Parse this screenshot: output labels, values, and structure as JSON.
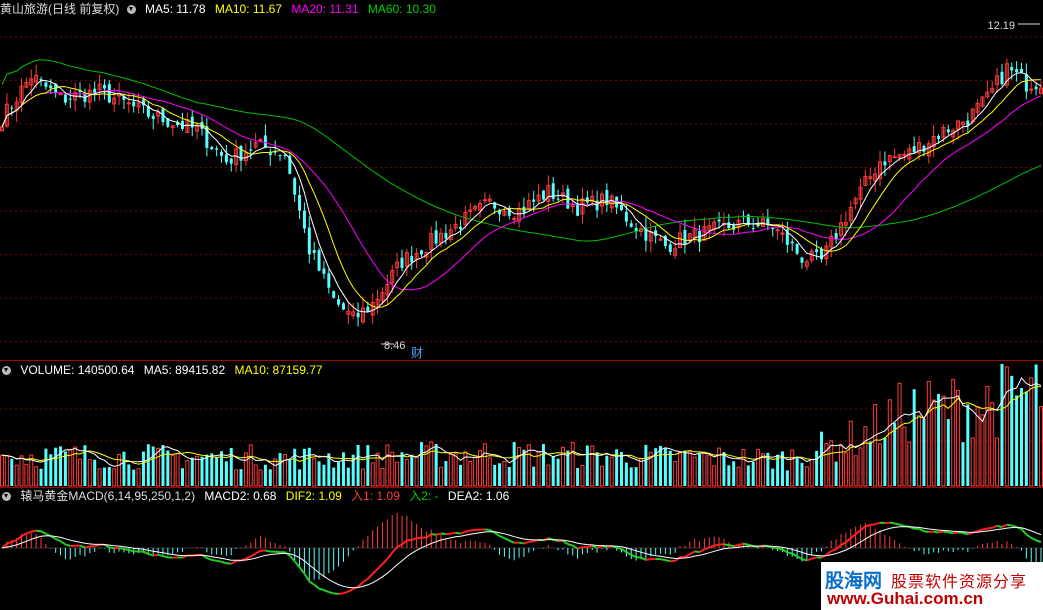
{
  "stock": {
    "name": "黄山旅游",
    "period": "(日线 前复权)"
  },
  "price_panel": {
    "ma5": "MA5: 11.78",
    "ma10": "MA10: 11.67",
    "ma20": "MA20: 11.31",
    "ma60": "MA60: 10.30",
    "high_label": "12.19",
    "low_label": "8.46",
    "event_marker": "财"
  },
  "volume_panel": {
    "volume": "VOLUME: 140500.64",
    "ma5": "MA5: 89415.82",
    "ma10": "MA10: 87159.77"
  },
  "macd_panel": {
    "name": "辕马黄金MACD(6,14,95,250,1,2)",
    "macd2": "MACD2: 0.68",
    "dif2": "DIF2: 1.09",
    "in1": "入1: 1.09",
    "in2": "入2: -",
    "dea2": "DEA2: 1.06"
  },
  "watermark": {
    "logo": "股海网",
    "tagline": "股票软件资源分享",
    "url": "www.Guhai.com.cn"
  },
  "colors": {
    "up": "#ff3c3c",
    "down": "#54ffff",
    "ma5": "#ffffff",
    "ma10": "#ffff00",
    "ma20": "#ff00ff",
    "ma60": "#00c000",
    "separator": "#a00000",
    "grid": "#7a0000"
  },
  "chart_data": [
    {
      "type": "candlestick",
      "title": "黄山旅游 (日线 前复权)",
      "ylim": [
        8.2,
        12.6
      ],
      "grid": true,
      "annotations": [
        {
          "text": "12.19",
          "kind": "period-high"
        },
        {
          "text": "8.46",
          "kind": "period-low"
        },
        {
          "text": "财",
          "kind": "event"
        }
      ],
      "anchors": [
        {
          "day": 0,
          "price": 11.3
        },
        {
          "day": 6,
          "price": 11.85
        },
        {
          "day": 12,
          "price": 11.55
        },
        {
          "day": 20,
          "price": 11.65
        },
        {
          "day": 30,
          "price": 11.35
        },
        {
          "day": 40,
          "price": 11.15
        },
        {
          "day": 46,
          "price": 10.75
        },
        {
          "day": 52,
          "price": 10.95
        },
        {
          "day": 58,
          "price": 10.85
        },
        {
          "day": 63,
          "price": 9.6
        },
        {
          "day": 68,
          "price": 8.95
        },
        {
          "day": 72,
          "price": 8.7
        },
        {
          "day": 76,
          "price": 8.9
        },
        {
          "day": 82,
          "price": 9.45
        },
        {
          "day": 88,
          "price": 9.7
        },
        {
          "day": 94,
          "price": 9.95
        },
        {
          "day": 100,
          "price": 10.2
        },
        {
          "day": 106,
          "price": 10.1
        },
        {
          "day": 112,
          "price": 10.35
        },
        {
          "day": 118,
          "price": 10.15
        },
        {
          "day": 124,
          "price": 10.25
        },
        {
          "day": 130,
          "price": 9.9
        },
        {
          "day": 136,
          "price": 9.65
        },
        {
          "day": 140,
          "price": 9.75
        },
        {
          "day": 146,
          "price": 9.85
        },
        {
          "day": 152,
          "price": 9.95
        },
        {
          "day": 158,
          "price": 9.9
        },
        {
          "day": 164,
          "price": 9.5
        },
        {
          "day": 168,
          "price": 9.45
        },
        {
          "day": 174,
          "price": 10.15
        },
        {
          "day": 180,
          "price": 10.75
        },
        {
          "day": 186,
          "price": 10.85
        },
        {
          "day": 192,
          "price": 11.1
        },
        {
          "day": 198,
          "price": 11.3
        },
        {
          "day": 202,
          "price": 11.55
        },
        {
          "day": 206,
          "price": 11.95
        },
        {
          "day": 210,
          "price": 11.75
        },
        {
          "day": 213,
          "price": 11.78
        }
      ],
      "series": [
        {
          "name": "MA5",
          "value": 11.78
        },
        {
          "name": "MA10",
          "value": 11.67
        },
        {
          "name": "MA20",
          "value": 11.31
        },
        {
          "name": "MA60",
          "value": 10.3
        }
      ]
    },
    {
      "type": "bar",
      "title": "VOLUME",
      "series": [
        {
          "name": "VOLUME",
          "value": 140500.64
        },
        {
          "name": "MA5",
          "value": 89415.82
        },
        {
          "name": "MA10",
          "value": 87159.77
        }
      ],
      "volume_profile": [
        {
          "day": 0,
          "value": 45000
        },
        {
          "day": 60,
          "value": 42000
        },
        {
          "day": 100,
          "value": 48000
        },
        {
          "day": 160,
          "value": 40000
        },
        {
          "day": 175,
          "value": 70000
        },
        {
          "day": 185,
          "value": 110000
        },
        {
          "day": 200,
          "value": 120000
        },
        {
          "day": 213,
          "value": 140500
        }
      ]
    },
    {
      "type": "line",
      "title": "辕马黄金MACD(6,14,95,250,1,2)",
      "series": [
        {
          "name": "MACD2",
          "value": 0.68
        },
        {
          "name": "DIF2",
          "value": 1.09
        },
        {
          "name": "入1",
          "value": 1.09
        },
        {
          "name": "DEA2",
          "value": 1.06
        }
      ]
    }
  ]
}
